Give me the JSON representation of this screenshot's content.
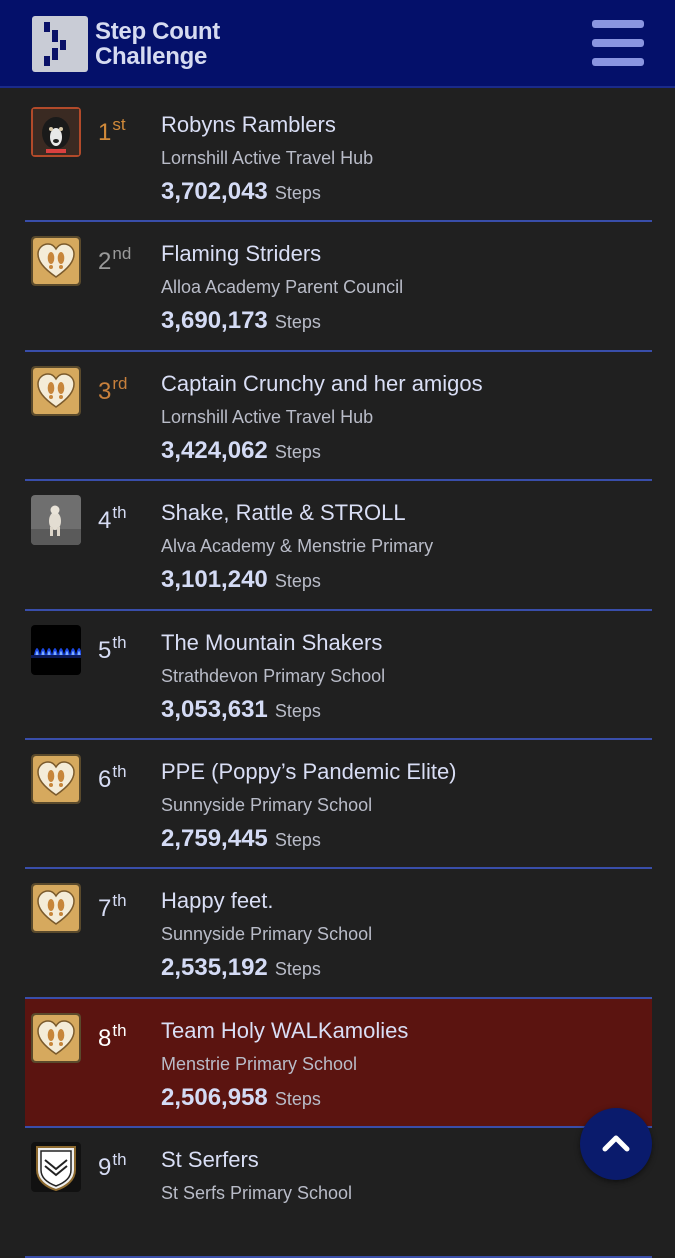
{
  "header": {
    "logo_line1": "Step Count",
    "logo_line2": "Challenge",
    "menu_icon": "hamburger-menu-icon",
    "colors": {
      "background": "#04106a",
      "menu": "#8a95e0"
    }
  },
  "steps_unit": "Steps",
  "rows": [
    {
      "rank": "1",
      "suffix": "st",
      "name": "Robyns Ramblers",
      "org": "Lornshill Active Travel Hub",
      "steps": "3,702,043",
      "avatar": "dog-photo",
      "rank_color": "#d18a3a"
    },
    {
      "rank": "2",
      "suffix": "nd",
      "name": "Flaming Striders",
      "org": "Alloa Academy Parent Council",
      "steps": "3,690,173",
      "avatar": "heart-footprints-badge",
      "rank_color": "#9a9a9a"
    },
    {
      "rank": "3",
      "suffix": "rd",
      "name": "Captain Crunchy and her amigos",
      "org": "Lornshill Active Travel Hub",
      "steps": "3,424,062",
      "avatar": "heart-footprints-badge",
      "rank_color": "#c8803c"
    },
    {
      "rank": "4",
      "suffix": "th",
      "name": "Shake, Rattle & STROLL",
      "org": "Alva Academy & Menstrie Primary",
      "steps": "3,101,240",
      "avatar": "small-dog-photo",
      "rank_color": "#d6dcf4"
    },
    {
      "rank": "5",
      "suffix": "th",
      "name": "The Mountain Shakers",
      "org": "Strathdevon Primary School",
      "steps": "3,053,631",
      "avatar": "blue-flame-photo",
      "rank_color": "#d6dcf4"
    },
    {
      "rank": "6",
      "suffix": "th",
      "name": "PPE (Poppy’s Pandemic Elite)",
      "org": "Sunnyside Primary School",
      "steps": "2,759,445",
      "avatar": "heart-footprints-badge",
      "rank_color": "#d6dcf4"
    },
    {
      "rank": "7",
      "suffix": "th",
      "name": "Happy feet.",
      "org": "Sunnyside Primary School",
      "steps": "2,535,192",
      "avatar": "heart-footprints-badge",
      "rank_color": "#d6dcf4"
    },
    {
      "rank": "8",
      "suffix": "th",
      "name": "Team Holy WALKamolies",
      "org": "Menstrie Primary School",
      "steps": "2,506,958",
      "avatar": "heart-footprints-badge",
      "rank_color": "#ffffff",
      "highlighted": true
    },
    {
      "rank": "9",
      "suffix": "th",
      "name": "St Serfers",
      "org": "St Serfs Primary School",
      "steps": "",
      "avatar": "school-crest-badge",
      "rank_color": "#d6dcf4"
    }
  ],
  "colors": {
    "page_background": "#202020",
    "divider": "#394eaa",
    "highlight_row": "#5b1410",
    "scroll_button": "#0a1b6c"
  },
  "scroll_top_icon": "chevron-up-icon"
}
